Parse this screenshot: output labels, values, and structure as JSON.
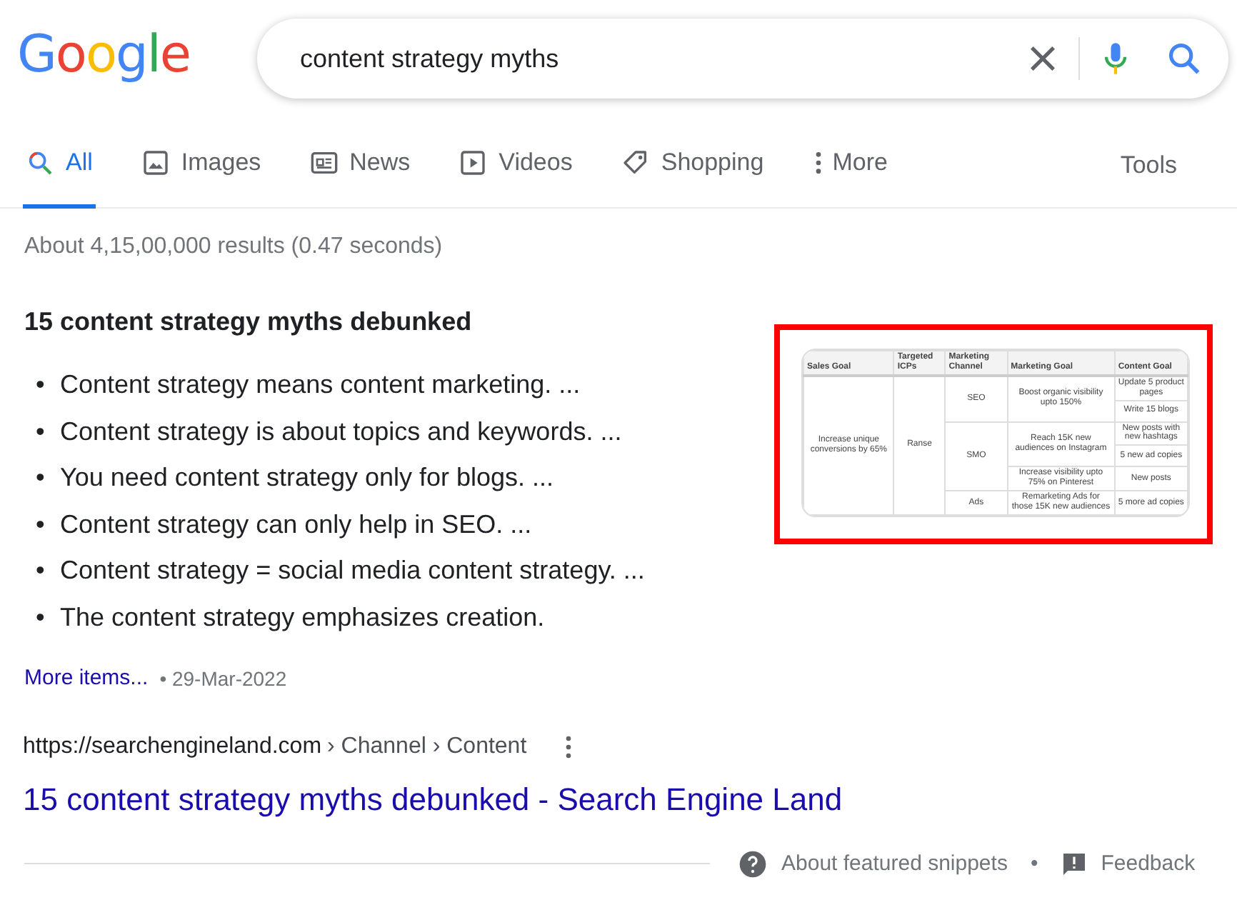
{
  "logo": "Google",
  "search": {
    "value": "content strategy myths"
  },
  "tabs": [
    {
      "label": "All",
      "kind": "all",
      "selected": true
    },
    {
      "label": "Images",
      "kind": "images",
      "selected": false
    },
    {
      "label": "News",
      "kind": "news",
      "selected": false
    },
    {
      "label": "Videos",
      "kind": "videos",
      "selected": false
    },
    {
      "label": "Shopping",
      "kind": "shopping",
      "selected": false
    },
    {
      "label": "More",
      "kind": "more",
      "selected": false
    }
  ],
  "tools": "Tools",
  "result_stats": "About 4,15,00,000 results (0.47 seconds)",
  "snippet": {
    "title": "15 content strategy myths debunked",
    "bullet": "•",
    "items": [
      "Content strategy means content marketing. ...",
      "Content strategy is about topics and keywords. ...",
      "You need content strategy only for blogs. ...",
      "Content strategy can only help in SEO. ...",
      "Content strategy = social media content strategy. ...",
      "The content strategy emphasizes creation."
    ],
    "more_link": "More items...",
    "date_separator": "•",
    "date": "29-Mar-2022",
    "thumbnail": {
      "highlighted": true,
      "columns": [
        "Sales Goal",
        "Targeted ICPs",
        "Marketing Channel",
        "Marketing Goal",
        "Content Goal"
      ],
      "rows": [
        [
          {
            "text": "Increase unique conversions by 65%",
            "rowspan": 6
          },
          {
            "text": "Ranse",
            "rowspan": 6
          },
          {
            "text": "SEO",
            "rowspan": 2
          },
          {
            "text": "Boost organic visibility upto 150%",
            "rowspan": 2
          },
          {
            "text": "Update 5 product pages"
          }
        ],
        [
          {
            "text": "Write 15 blogs"
          }
        ],
        [
          {
            "text": "SMO",
            "rowspan": 3
          },
          {
            "text": "Reach 15K new audiences on Instagram",
            "rowspan": 2
          },
          {
            "text": "New posts with new hashtags"
          }
        ],
        [
          {
            "text": "5 new ad copies"
          }
        ],
        [
          {
            "text": "Increase visibility upto 75% on Pinterest"
          },
          {
            "text": "New posts"
          }
        ],
        [
          {
            "text": "Ads"
          },
          {
            "text": "Remarketing Ads for those 15K new audiences"
          },
          {
            "text": "5 more ad copies"
          }
        ]
      ]
    }
  },
  "source": {
    "url": "https://searchengineland.com",
    "breadcrumb": "› Channel › Content",
    "title": "15 content strategy myths debunked - Search Engine Land"
  },
  "footer": {
    "about": "About featured snippets",
    "separator": "•",
    "feedback": "Feedback"
  }
}
